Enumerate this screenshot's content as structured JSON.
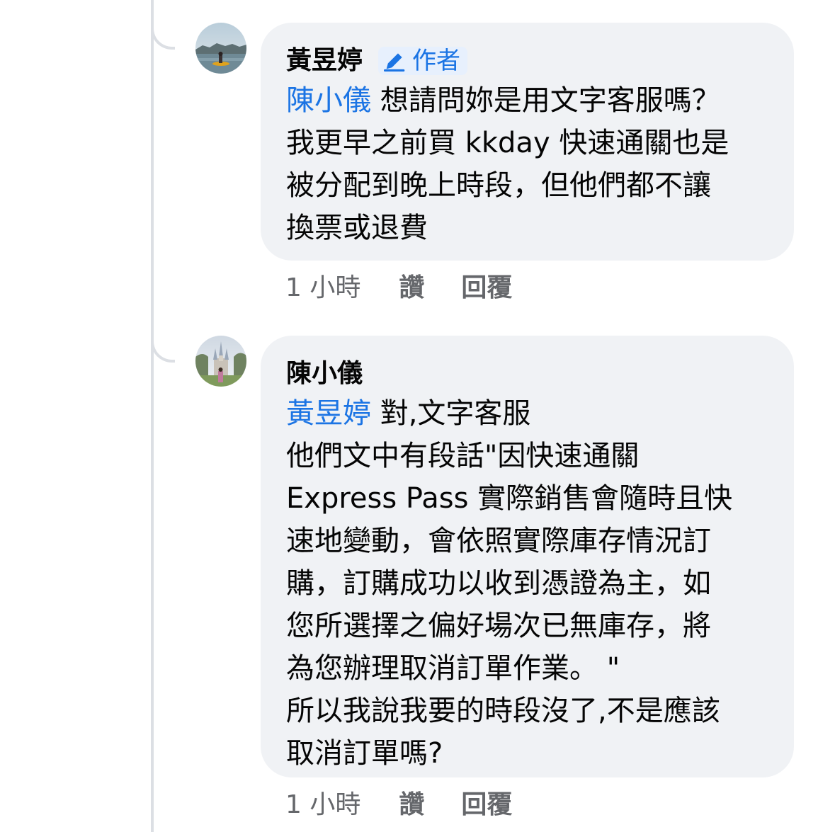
{
  "comments": [
    {
      "author": "黃昱婷",
      "badge": "作者",
      "mention": "陳小儀",
      "first_line_rest": " 想請問妳是用文字客服嗎？",
      "lines": [
        "我更早之前買 kkday 快速通關也是",
        "被分配到晚上時段，但他們都不讓",
        "換票或退費"
      ],
      "time": "1 小時",
      "like": "讚",
      "reply": "回覆"
    },
    {
      "author": "陳小儀",
      "mention": "黃昱婷",
      "first_line_rest": " 對,文字客服",
      "lines": [
        "他們文中有段話\"因快速通關",
        "Express Pass 實際銷售會隨時且快",
        "速地變動，會依照實際庫存情況訂",
        "購，訂購成功以收到憑證為主，如",
        "您所選擇之偏好場次已無庫存，將",
        "為您辦理取消訂單作業。 \"",
        "所以我說我要的時段沒了,不是應該",
        "取消訂單嗎?"
      ],
      "time": "1 小時",
      "like": "讚",
      "reply": "回覆"
    }
  ],
  "colors": {
    "mention": "#1b74e4",
    "bubble": "#f0f2f5",
    "meta": "#65676b",
    "thread_line": "#dcdfe4"
  },
  "icons": {
    "badge_icon": "pencil-icon"
  }
}
